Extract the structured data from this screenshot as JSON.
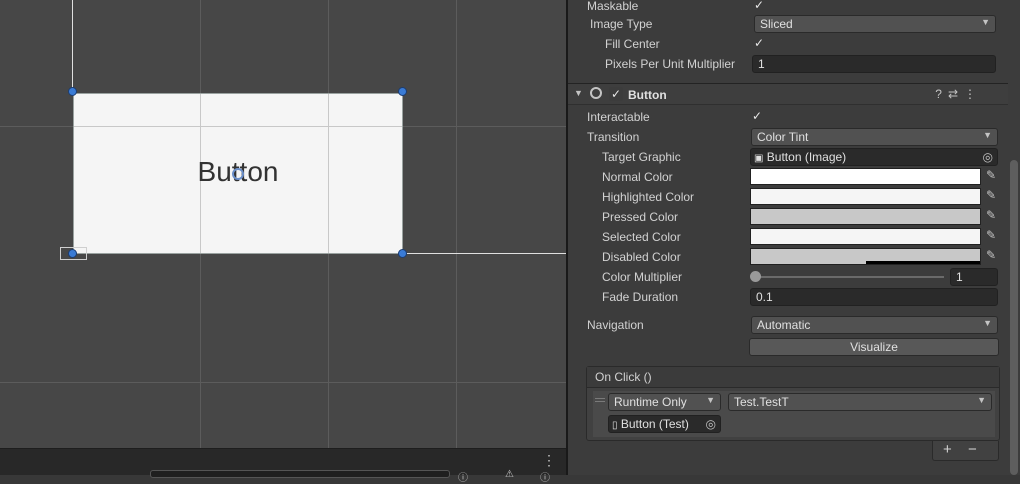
{
  "scene": {
    "button_label": "Button",
    "bottom_menu_icon": "kebab-menu-icon"
  },
  "inspector": {
    "image": {
      "maskable_label": "Maskable",
      "maskable_checked": true,
      "image_type_label": "Image Type",
      "image_type_value": "Sliced",
      "fill_center_label": "Fill Center",
      "fill_center_checked": true,
      "ppu_label": "Pixels Per Unit Multiplier",
      "ppu_value": "1"
    },
    "button": {
      "title": "Button",
      "enabled": true,
      "interactable_label": "Interactable",
      "interactable_checked": true,
      "transition_label": "Transition",
      "transition_value": "Color Tint",
      "target_graphic_label": "Target Graphic",
      "target_graphic_value": "Button (Image)",
      "normal_color_label": "Normal Color",
      "normal_color": "#ffffff",
      "highlighted_color_label": "Highlighted Color",
      "highlighted_color": "#f5f5f5",
      "pressed_color_label": "Pressed Color",
      "pressed_color": "#c8c8c8",
      "selected_color_label": "Selected Color",
      "selected_color": "#f5f5f5",
      "disabled_color_label": "Disabled Color",
      "disabled_color": "#c8c8c8",
      "color_multiplier_label": "Color Multiplier",
      "color_multiplier_value": "1",
      "fade_duration_label": "Fade Duration",
      "fade_duration_value": "0.1",
      "navigation_label": "Navigation",
      "navigation_value": "Automatic",
      "visualize_label": "Visualize",
      "on_click": {
        "header": "On Click ()",
        "runtime_value": "Runtime Only",
        "function_value": "Test.TestT",
        "object_value": "Button (Test)",
        "add_label": "+",
        "remove_label": "−"
      }
    }
  }
}
